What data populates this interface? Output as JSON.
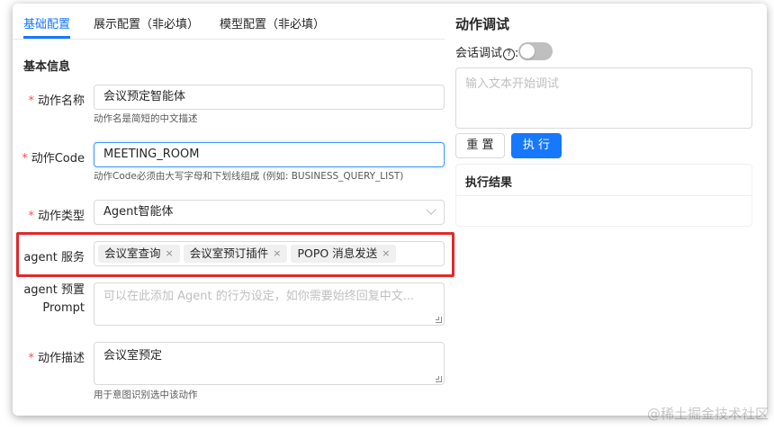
{
  "tabs": [
    {
      "label": "基础配置",
      "active": true
    },
    {
      "label": "展示配置（非必填）",
      "active": false
    },
    {
      "label": "模型配置（非必填）",
      "active": false
    }
  ],
  "section_title": "基本信息",
  "form": {
    "required_mark": "*",
    "action_name": {
      "label": "动作名称",
      "value": "会议预定智能体",
      "help": "动作名是简短的中文描述"
    },
    "action_code": {
      "label": "动作Code",
      "value": "MEETING_ROOM",
      "help": "动作Code必须由大写字母和下划线组成 (例如: BUSINESS_QUERY_LIST)"
    },
    "action_type": {
      "label": "动作类型",
      "value": "Agent智能体"
    },
    "agent_service": {
      "label": "agent 服务",
      "tags": [
        {
          "label": "会议室查询",
          "close": "×"
        },
        {
          "label": "会议室预订插件",
          "close": "×"
        },
        {
          "label": "POPO 消息发送",
          "close": "×"
        }
      ]
    },
    "agent_prompt": {
      "label_line1": "agent 预置",
      "label_line2": "Prompt",
      "placeholder": "可以在此添加 Agent 的行为设定，如你需要始终回复中文..."
    },
    "action_desc": {
      "label": "动作描述",
      "value": "会议室预定",
      "help": "用于意图识别选中该动作"
    }
  },
  "debug": {
    "title": "动作调试",
    "session_debug_label": "会话调试",
    "question_mark": "?",
    "colon": ":",
    "session_debug_on": false,
    "input_placeholder": "输入文本开始调试",
    "reset_label": "重 置",
    "run_label": "执 行",
    "result_title": "执行结果"
  },
  "watermark": "@稀土掘金技术社区",
  "colors": {
    "accent": "#1677ff",
    "required": "#ff4d4f",
    "highlight": "#e0292b"
  }
}
